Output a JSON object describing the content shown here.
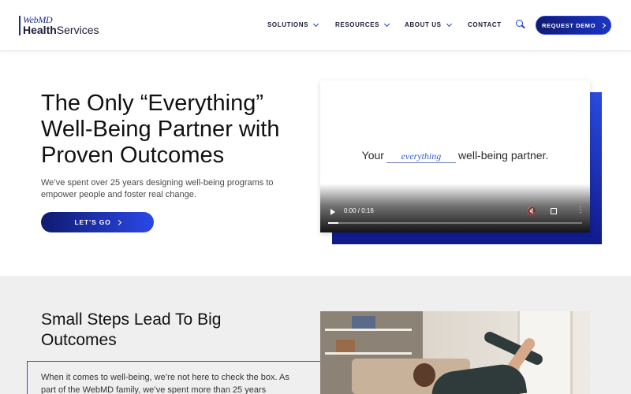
{
  "header": {
    "logo": {
      "brand_top": "WebMD",
      "brand_bold": "Health",
      "brand_rest": "Services"
    },
    "nav": [
      {
        "label": "SOLUTIONS",
        "dropdown": true
      },
      {
        "label": "RESOURCES",
        "dropdown": true
      },
      {
        "label": "ABOUT US",
        "dropdown": true
      },
      {
        "label": "CONTACT",
        "dropdown": false
      }
    ],
    "search_icon": "search-icon",
    "cta_label": "REQUEST DEMO"
  },
  "hero": {
    "title": "The Only “Everything” Well-Being Partner with Proven Outcomes",
    "subtitle": "We’ve spent over 25 years designing well-being programs to empower people and foster real change.",
    "cta_label": "LET’S GO",
    "video": {
      "tagline_before": "Your",
      "tagline_highlight": "everything",
      "tagline_after": "well-being partner.",
      "time": "0:00 / 0:16",
      "progress": 0.0
    }
  },
  "section2": {
    "title": "Small Steps Lead To Big Outcomes",
    "body": "When it comes to well-being, we’re not here to check the box. As part of the WebMD family, we’ve spent more than 25 years"
  },
  "colors": {
    "accent": "#1a3bd6",
    "brand_dark": "#101a6e",
    "section_bg": "#efefef"
  }
}
